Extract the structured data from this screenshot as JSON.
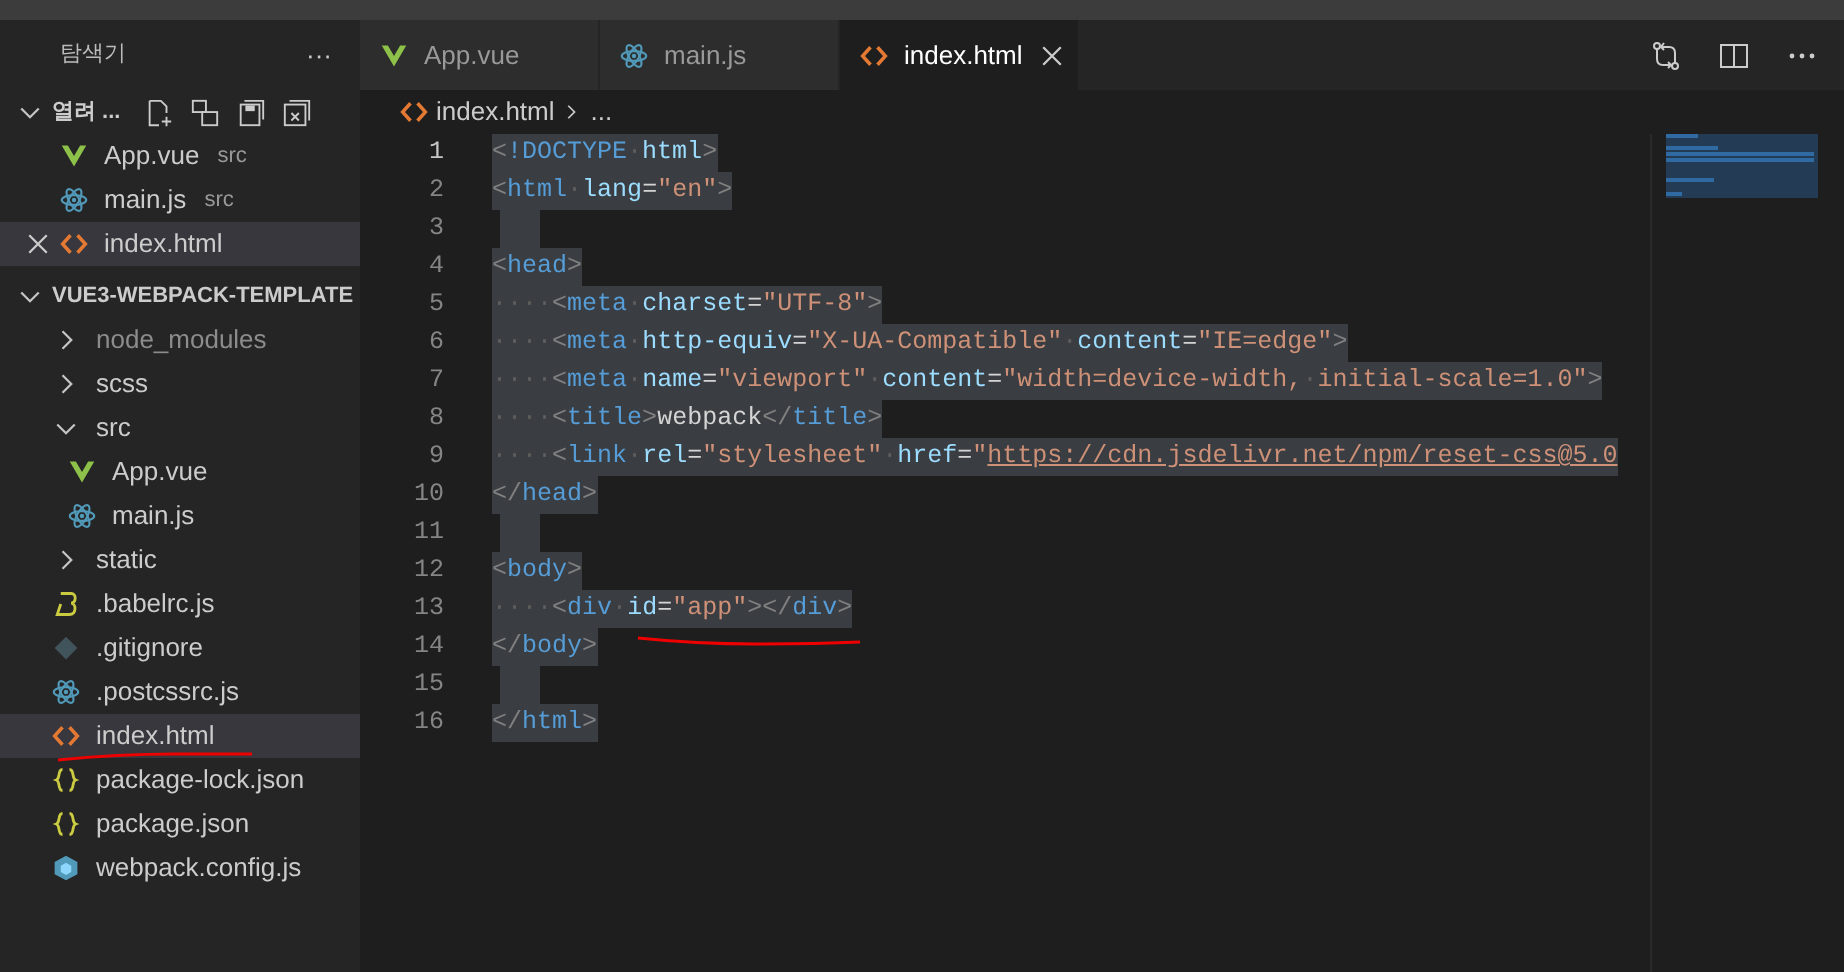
{
  "sidebar": {
    "title": "탐색기",
    "more": "···",
    "open_editors": {
      "label": "열려 ...",
      "expanded": true,
      "items": [
        {
          "name": "App.vue",
          "description": "src",
          "kind": "vue",
          "selected": false
        },
        {
          "name": "main.js",
          "description": "src",
          "kind": "atom",
          "selected": false
        },
        {
          "name": "index.html",
          "kind": "html",
          "selected": true
        }
      ]
    },
    "folder": {
      "label": "VUE3-WEBPACK-TEMPLATE",
      "expanded": true,
      "children": [
        {
          "name": "node_modules",
          "kind": "folder",
          "expanded": false,
          "ignored": true
        },
        {
          "name": "scss",
          "kind": "folder",
          "expanded": false,
          "ignored": false
        },
        {
          "name": "src",
          "kind": "folder",
          "expanded": true,
          "ignored": false,
          "children": [
            {
              "name": "App.vue",
              "kind": "vue",
              "selected": false
            },
            {
              "name": "main.js",
              "kind": "atom",
              "selected": false
            }
          ]
        },
        {
          "name": "static",
          "kind": "folder",
          "expanded": false,
          "ignored": false
        },
        {
          "name": ".babelrc.js",
          "kind": "babel",
          "selected": false
        },
        {
          "name": ".gitignore",
          "kind": "git",
          "selected": false
        },
        {
          "name": ".postcssrc.js",
          "kind": "atom",
          "selected": false
        },
        {
          "name": "index.html",
          "kind": "html",
          "selected": true
        },
        {
          "name": "package-lock.json",
          "kind": "json",
          "selected": false
        },
        {
          "name": "package.json",
          "kind": "json",
          "selected": false
        },
        {
          "name": "webpack.config.js",
          "kind": "webpack",
          "selected": false
        }
      ]
    }
  },
  "tabs": [
    {
      "label": "App.vue",
      "kind": "vue",
      "selected": false
    },
    {
      "label": "main.js",
      "kind": "atom",
      "selected": false
    },
    {
      "label": "index.html",
      "kind": "html",
      "selected": true
    }
  ],
  "breadcrumb": {
    "file": "index.html",
    "kind": "html",
    "rest": "..."
  },
  "editor": {
    "lines": [
      {
        "number": "1",
        "current": true,
        "tokens": [
          {
            "kind": "punct",
            "text": "<"
          },
          {
            "kind": "tag",
            "text": "!DOCTYPE"
          },
          {
            "kind": "space",
            "text": "·"
          },
          {
            "kind": "attr",
            "text": "html"
          },
          {
            "kind": "punct",
            "text": ">"
          }
        ]
      },
      {
        "number": "2",
        "current": false,
        "tokens": [
          {
            "kind": "punct",
            "text": "<"
          },
          {
            "kind": "tag",
            "text": "html"
          },
          {
            "kind": "space",
            "text": "·"
          },
          {
            "kind": "attr",
            "text": "lang"
          },
          {
            "kind": "plain",
            "text": "="
          },
          {
            "kind": "string",
            "text": "\"en\""
          },
          {
            "kind": "punct",
            "text": ">"
          }
        ]
      },
      {
        "number": "3",
        "current": false
      },
      {
        "number": "4",
        "current": false,
        "tokens": [
          {
            "kind": "punct",
            "text": "<"
          },
          {
            "kind": "tag",
            "text": "head"
          },
          {
            "kind": "punct",
            "text": ">"
          }
        ]
      },
      {
        "number": "5",
        "current": false,
        "tokens": [
          {
            "kind": "space",
            "text": "····"
          },
          {
            "kind": "punct",
            "text": "<"
          },
          {
            "kind": "tag",
            "text": "meta"
          },
          {
            "kind": "space",
            "text": "·"
          },
          {
            "kind": "attr",
            "text": "charset"
          },
          {
            "kind": "plain",
            "text": "="
          },
          {
            "kind": "string",
            "text": "\"UTF-8\""
          },
          {
            "kind": "punct",
            "text": ">"
          }
        ]
      },
      {
        "number": "6",
        "current": false,
        "tokens": [
          {
            "kind": "space",
            "text": "····"
          },
          {
            "kind": "punct",
            "text": "<"
          },
          {
            "kind": "tag",
            "text": "meta"
          },
          {
            "kind": "space",
            "text": "·"
          },
          {
            "kind": "attr",
            "text": "http-equiv"
          },
          {
            "kind": "plain",
            "text": "="
          },
          {
            "kind": "string",
            "text": "\"X-UA-Compatible\""
          },
          {
            "kind": "space",
            "text": "·"
          },
          {
            "kind": "attr",
            "text": "content"
          },
          {
            "kind": "plain",
            "text": "="
          },
          {
            "kind": "string",
            "text": "\"IE=edge\""
          },
          {
            "kind": "punct",
            "text": ">"
          }
        ]
      },
      {
        "number": "7",
        "current": false,
        "tokens": [
          {
            "kind": "space",
            "text": "····"
          },
          {
            "kind": "punct",
            "text": "<"
          },
          {
            "kind": "tag",
            "text": "meta"
          },
          {
            "kind": "space",
            "text": "·"
          },
          {
            "kind": "attr",
            "text": "name"
          },
          {
            "kind": "plain",
            "text": "="
          },
          {
            "kind": "string",
            "text": "\"viewport\""
          },
          {
            "kind": "space",
            "text": "·"
          },
          {
            "kind": "attr",
            "text": "content"
          },
          {
            "kind": "plain",
            "text": "="
          },
          {
            "kind": "string",
            "text": "\"width=device-width,"
          },
          {
            "kind": "space",
            "text": "·"
          },
          {
            "kind": "string",
            "text": "initial-scale=1.0\""
          },
          {
            "kind": "punct",
            "text": ">"
          }
        ]
      },
      {
        "number": "8",
        "current": false,
        "tokens": [
          {
            "kind": "space",
            "text": "····"
          },
          {
            "kind": "punct",
            "text": "<"
          },
          {
            "kind": "tag",
            "text": "title"
          },
          {
            "kind": "punct",
            "text": ">"
          },
          {
            "kind": "plain",
            "text": "webpack"
          },
          {
            "kind": "punct",
            "text": "</"
          },
          {
            "kind": "tag",
            "text": "title"
          },
          {
            "kind": "punct",
            "text": ">"
          }
        ]
      },
      {
        "number": "9",
        "current": false,
        "tokens": [
          {
            "kind": "space",
            "text": "····"
          },
          {
            "kind": "punct",
            "text": "<"
          },
          {
            "kind": "tag",
            "text": "link"
          },
          {
            "kind": "space",
            "text": "·"
          },
          {
            "kind": "attr",
            "text": "rel"
          },
          {
            "kind": "plain",
            "text": "="
          },
          {
            "kind": "string",
            "text": "\"stylesheet\""
          },
          {
            "kind": "space",
            "text": "·"
          },
          {
            "kind": "attr",
            "text": "href"
          },
          {
            "kind": "plain",
            "text": "="
          },
          {
            "kind": "string",
            "text": "\""
          },
          {
            "kind": "link",
            "text": "https://cdn.jsdelivr.net/npm/reset-css@5.0"
          }
        ]
      },
      {
        "number": "10",
        "current": false,
        "tokens": [
          {
            "kind": "punct",
            "text": "</"
          },
          {
            "kind": "tag",
            "text": "head"
          },
          {
            "kind": "punct",
            "text": ">"
          }
        ]
      },
      {
        "number": "11",
        "current": false
      },
      {
        "number": "12",
        "current": false,
        "tokens": [
          {
            "kind": "punct",
            "text": "<"
          },
          {
            "kind": "tag",
            "text": "body"
          },
          {
            "kind": "punct",
            "text": ">"
          }
        ]
      },
      {
        "number": "13",
        "current": false,
        "tokens": [
          {
            "kind": "space",
            "text": "····"
          },
          {
            "kind": "punct",
            "text": "<"
          },
          {
            "kind": "tag",
            "text": "div"
          },
          {
            "kind": "space",
            "text": "·"
          },
          {
            "kind": "attr",
            "text": "id"
          },
          {
            "kind": "plain",
            "text": "="
          },
          {
            "kind": "string",
            "text": "\"app\""
          },
          {
            "kind": "punct",
            "text": "></"
          },
          {
            "kind": "tag",
            "text": "div"
          },
          {
            "kind": "punct",
            "text": ">"
          }
        ]
      },
      {
        "number": "14",
        "current": false,
        "tokens": [
          {
            "kind": "punct",
            "text": "</"
          },
          {
            "kind": "tag",
            "text": "body"
          },
          {
            "kind": "punct",
            "text": ">"
          }
        ]
      },
      {
        "number": "15",
        "current": false
      },
      {
        "number": "16",
        "current": false,
        "tokens": [
          {
            "kind": "punct",
            "text": "</"
          },
          {
            "kind": "tag",
            "text": "html"
          },
          {
            "kind": "punct",
            "text": ">"
          }
        ]
      }
    ]
  }
}
